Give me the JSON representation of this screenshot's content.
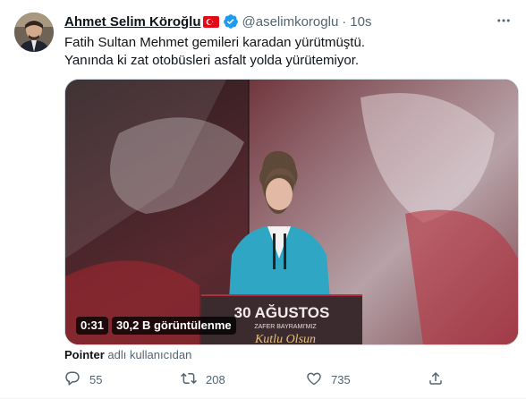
{
  "tweet": {
    "author_name": "Ahmet Selim Köroğlu",
    "handle": "@aselimkoroglu",
    "separator": "·",
    "time": "10s",
    "text_lines": [
      "Fatih Sultan Mehmet gemileri karadan yürütmüştü.",
      "Yanında ki zat otobüsleri asfalt yolda yürütemiyor."
    ],
    "media": {
      "duration": "0:31",
      "views": "30,2 B görüntülenme",
      "banner_line1": "30 AĞUSTOS",
      "banner_line2": "ZAFER BAYRAMI'MIZ",
      "banner_line3": "Kutlu Olsun"
    },
    "attribution": {
      "user": "Pointer",
      "suffix": "adlı kullanıcıdan"
    },
    "actions": {
      "replies": "55",
      "retweets": "208",
      "likes": "735"
    }
  },
  "colors": {
    "accent": "#1d9bf0",
    "muted": "#536471",
    "flag_red": "#e30a17"
  }
}
